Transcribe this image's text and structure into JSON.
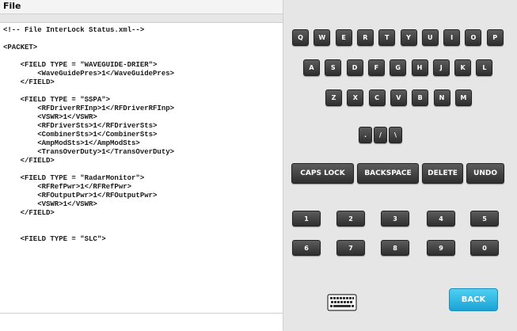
{
  "menu": {
    "file_label": "File"
  },
  "editor": {
    "lines": [
      "<!-- File InterLock Status.xml-->",
      "",
      "<PACKET>",
      "",
      "    <FIELD TYPE = \"WAVEGUIDE-DRIER\">",
      "        <WaveGuidePres>1</WaveGuidePres>",
      "    </FIELD>",
      "",
      "    <FIELD TYPE = \"SSPA\">",
      "        <RFDriverRFInp>1</RFDriverRFInp>",
      "        <VSWR>1</VSWR>",
      "        <RFDriverSts>1</RFDriverSts>",
      "        <CombinerSts>1</CombinerSts>",
      "        <AmpModSts>1</AmpModSts>",
      "        <TransOverDuty>1</TransOverDuty>",
      "    </FIELD>",
      "",
      "    <FIELD TYPE = \"RadarMonitor\">",
      "        <RFRefPwr>1</RFRefPwr>",
      "        <RFOutputPwr>1</RFOutputPwr>",
      "        <VSWR>1</VSWR>",
      "    </FIELD>",
      "",
      "",
      "    <FIELD TYPE = \"SLC\">"
    ]
  },
  "keyboard": {
    "row1": [
      "Q",
      "W",
      "E",
      "R",
      "T",
      "Y",
      "U",
      "I",
      "O",
      "P"
    ],
    "row2": [
      "A",
      "S",
      "D",
      "F",
      "G",
      "H",
      "J",
      "K",
      "L"
    ],
    "row3": [
      "Z",
      "X",
      "C",
      "V",
      "B",
      "N",
      "M"
    ],
    "row4": [
      ".",
      "/",
      "\\"
    ],
    "actions": [
      "CAPS LOCK",
      "BACKSPACE",
      "DELETE",
      "UNDO"
    ],
    "num_row1": [
      "1",
      "2",
      "3",
      "4",
      "5"
    ],
    "num_row2": [
      "6",
      "7",
      "8",
      "9",
      "0"
    ],
    "keyboard_icon": "keyboard-icon",
    "back_label": "BACK"
  },
  "colors": {
    "key_top": "#5c5c5c",
    "key_bottom": "#2e2e2e",
    "back_top": "#4fd0f3",
    "back_bottom": "#1aa3d4",
    "panel_bg": "#e6e6e6"
  }
}
